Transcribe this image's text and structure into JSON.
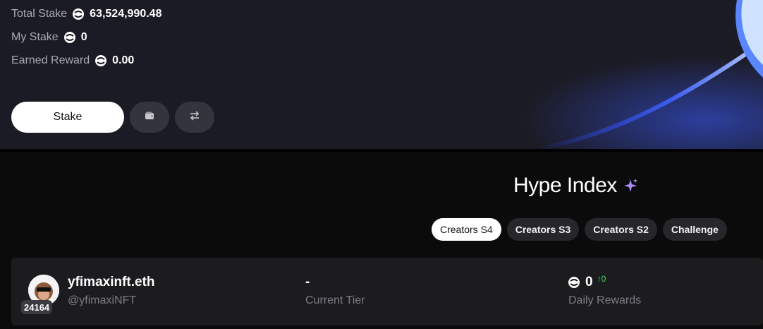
{
  "stats": {
    "total_stake_label": "Total Stake",
    "total_stake_value": "63,524,990.48",
    "my_stake_label": "My Stake",
    "my_stake_value": "0",
    "earned_reward_label": "Earned Reward",
    "earned_reward_value": "0.00"
  },
  "actions": {
    "stake_label": "Stake",
    "wallet_icon": "wallet-icon",
    "swap_icon": "swap-arrows-icon"
  },
  "hype": {
    "title": "Hype Index",
    "title_icon": "sparkle-icon",
    "tabs": [
      {
        "label": "Creators S4",
        "active": true
      },
      {
        "label": "Creators S3",
        "active": false
      },
      {
        "label": "Creators S2",
        "active": false
      },
      {
        "label": "Challenge",
        "active": false
      }
    ]
  },
  "row": {
    "rank": "24164",
    "name": "yfimaxinft.eth",
    "handle": "@yfimaxiNFT",
    "tier_value": "-",
    "tier_label": "Current Tier",
    "rewards_value": "0",
    "rewards_delta": "↑0",
    "rewards_label": "Daily Rewards"
  },
  "colors": {
    "accent_green": "#3ddc6a",
    "sparkle_purple": "#a98bff",
    "glow_blue": "#3a5bff"
  }
}
